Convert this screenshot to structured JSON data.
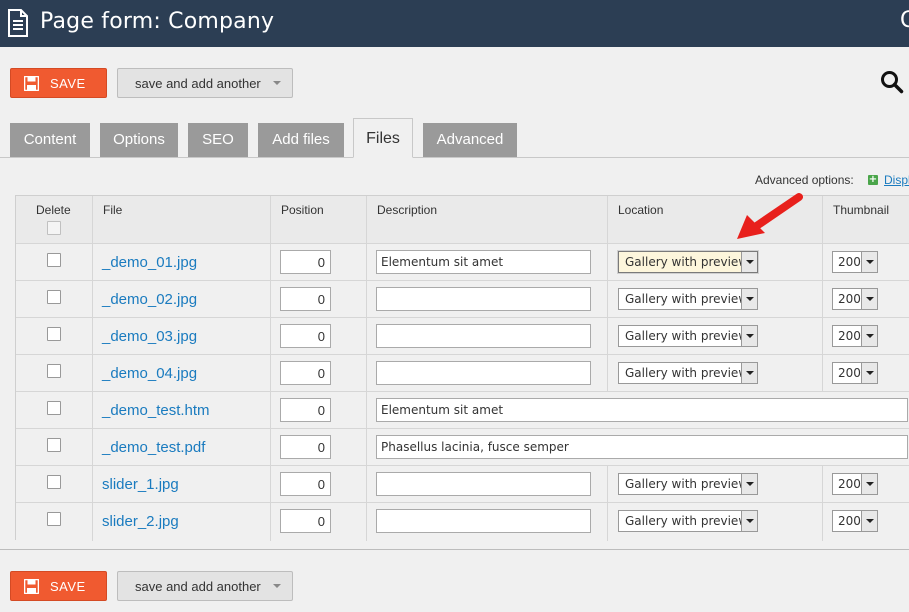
{
  "header": {
    "title": "Page form: Company",
    "edge_char": "C"
  },
  "toolbar": {
    "save_label": "SAVE",
    "save_another_label": "save and add another"
  },
  "tabs": [
    {
      "label": "Content",
      "active": false
    },
    {
      "label": "Options",
      "active": false
    },
    {
      "label": "SEO",
      "active": false
    },
    {
      "label": "Add files",
      "active": false
    },
    {
      "label": "Files",
      "active": true
    },
    {
      "label": "Advanced",
      "active": false
    }
  ],
  "advanced": {
    "label": "Advanced options:",
    "link": "Display"
  },
  "table": {
    "columns": [
      "Delete",
      "File",
      "Position",
      "Description",
      "Location",
      "Thumbnail"
    ],
    "rows": [
      {
        "file": "_demo_01.jpg",
        "position": "0",
        "description": "Elementum sit amet",
        "location": "Gallery with preview",
        "thumbnail": "200"
      },
      {
        "file": "_demo_02.jpg",
        "position": "0",
        "description": "",
        "location": "Gallery with preview",
        "thumbnail": "200"
      },
      {
        "file": "_demo_03.jpg",
        "position": "0",
        "description": "",
        "location": "Gallery with preview",
        "thumbnail": "200"
      },
      {
        "file": "_demo_04.jpg",
        "position": "0",
        "description": "",
        "location": "Gallery with preview",
        "thumbnail": "200"
      },
      {
        "file": "_demo_test.htm",
        "position": "0",
        "description": "Elementum sit amet"
      },
      {
        "file": "_demo_test.pdf",
        "position": "0",
        "description": "Phasellus lacinia, fusce semper"
      },
      {
        "file": "slider_1.jpg",
        "position": "0",
        "description": "",
        "location": "Gallery with preview",
        "thumbnail": "200"
      },
      {
        "file": "slider_2.jpg",
        "position": "0",
        "description": "",
        "location": "Gallery with preview",
        "thumbnail": "200"
      }
    ]
  },
  "colors": {
    "header_bg": "#2c3e54",
    "save_bg": "#f05a30",
    "link": "#1a7bbf",
    "tab_bg": "#9a9a9a",
    "arrow": "#e8201c"
  }
}
